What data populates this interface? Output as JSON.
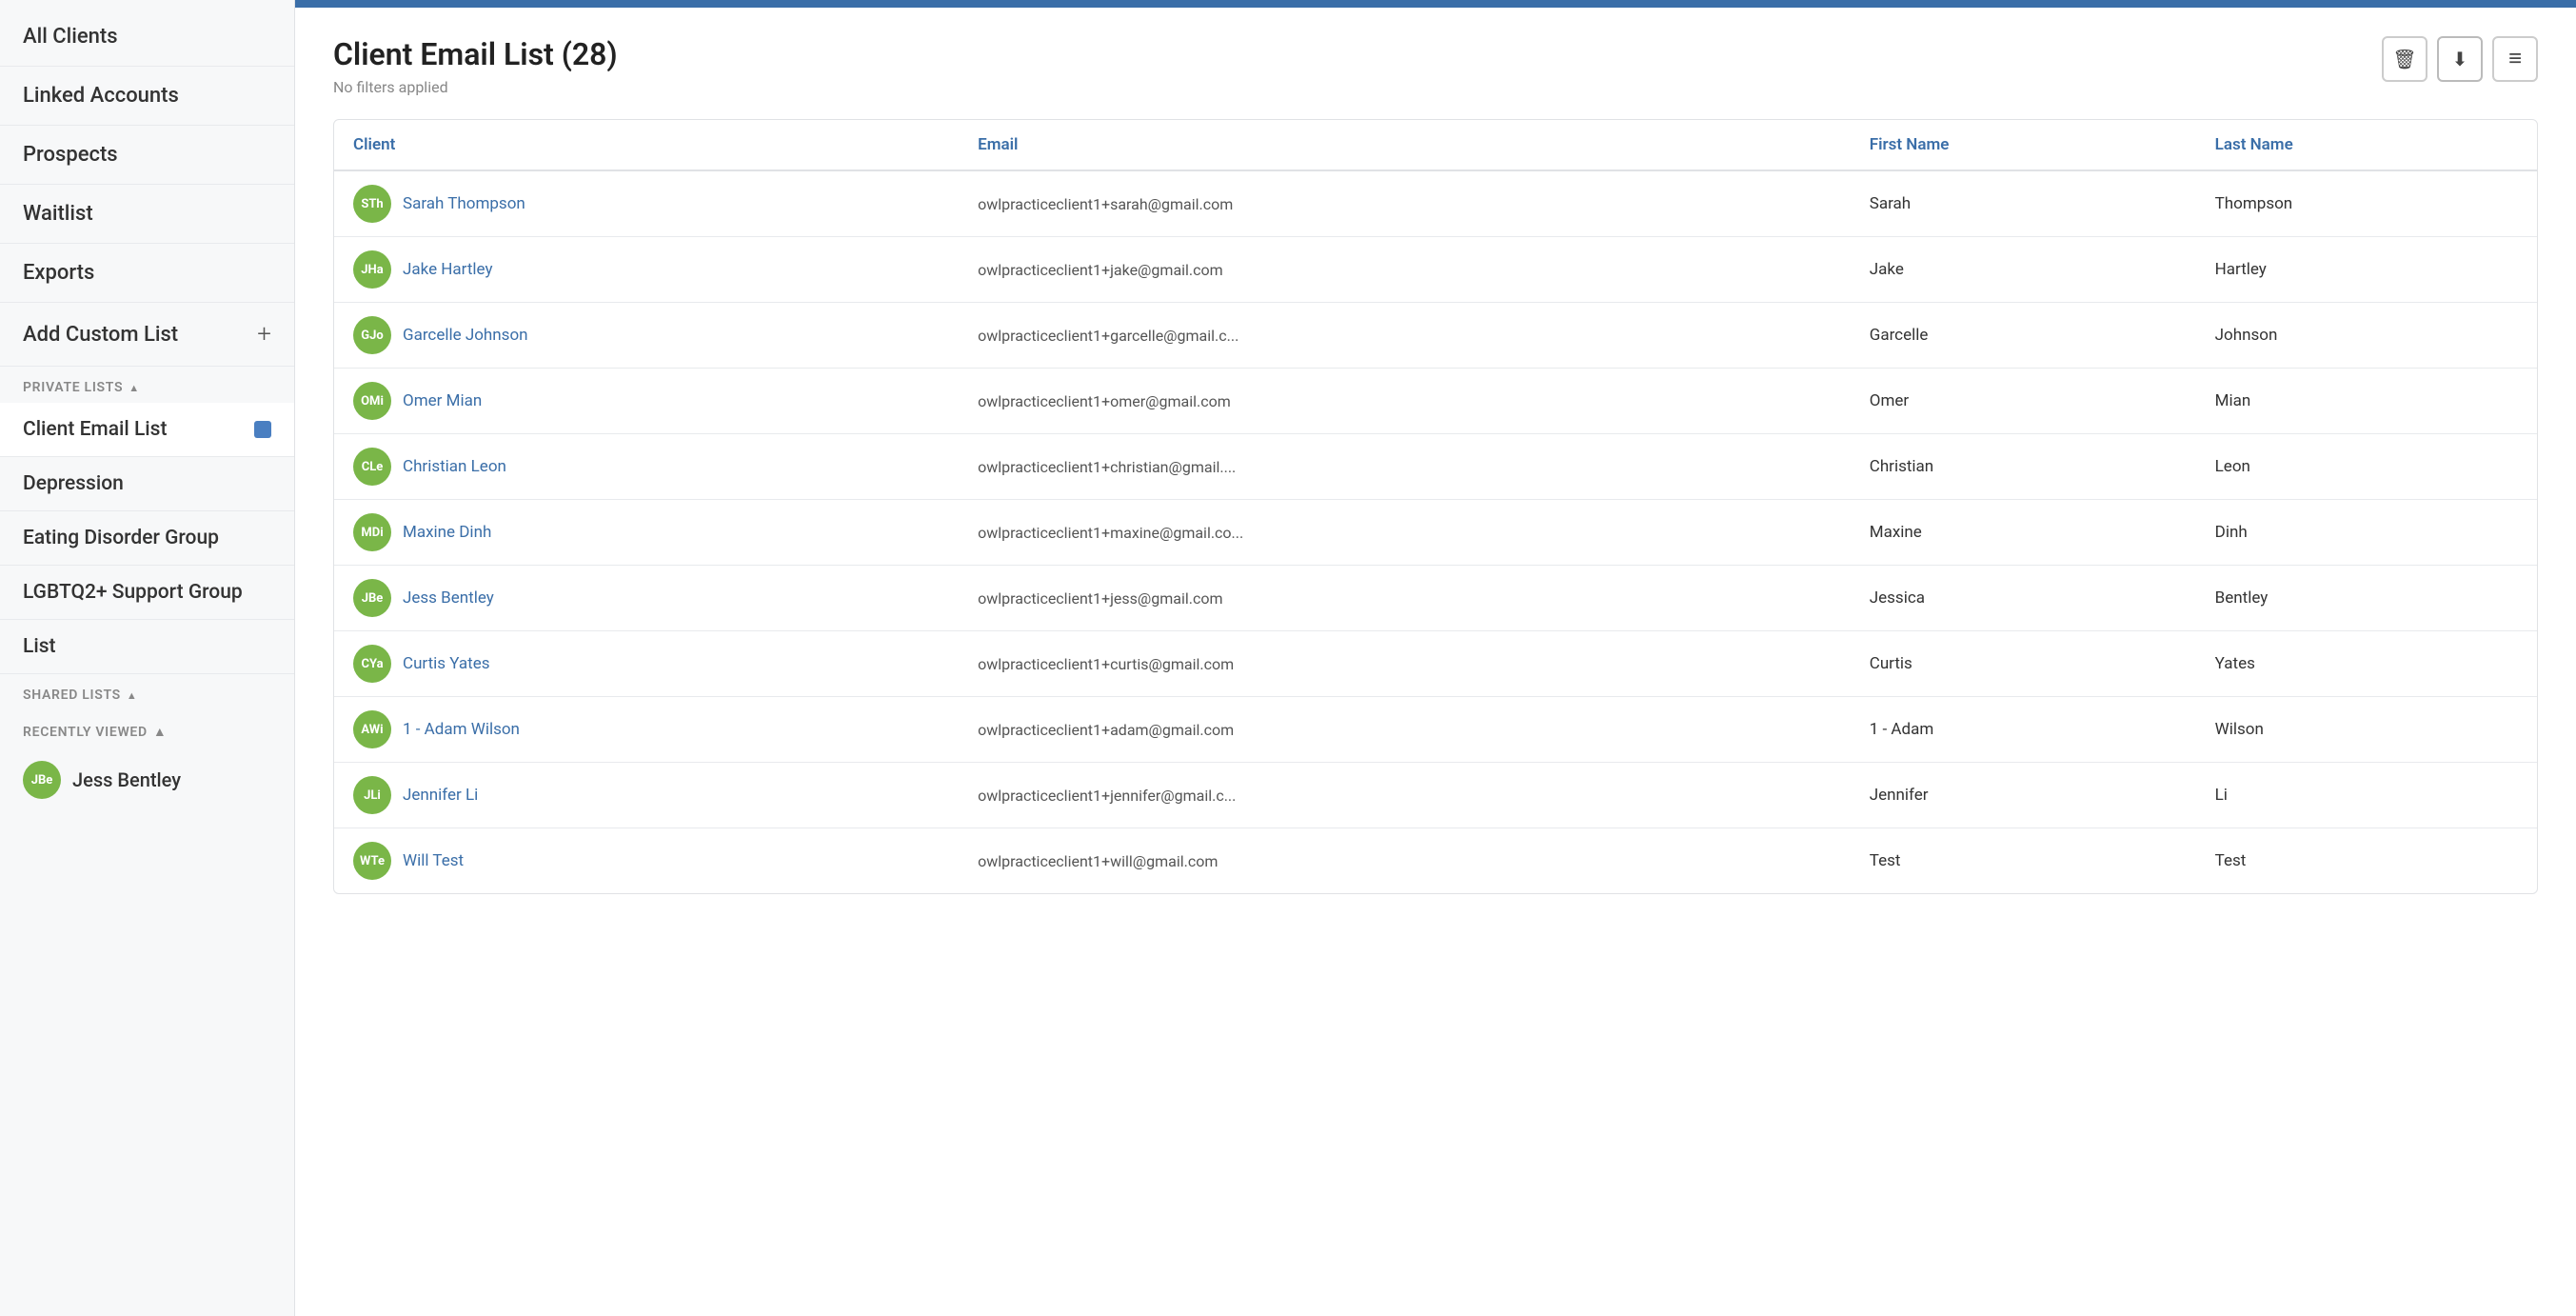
{
  "topBar": {
    "color": "#3a6ea8"
  },
  "sidebar": {
    "nav": [
      {
        "id": "all-clients",
        "label": "All Clients"
      },
      {
        "id": "linked-accounts",
        "label": "Linked Accounts"
      },
      {
        "id": "prospects",
        "label": "Prospects"
      },
      {
        "id": "waitlist",
        "label": "Waitlist"
      },
      {
        "id": "exports",
        "label": "Exports"
      }
    ],
    "addCustomList": {
      "label": "Add Custom List",
      "plus": "+"
    },
    "privateLists": {
      "sectionLabel": "PRIVATE LISTS",
      "items": [
        {
          "id": "client-email-list",
          "label": "Client Email List",
          "active": true,
          "hasDot": true
        },
        {
          "id": "depression",
          "label": "Depression",
          "active": false,
          "hasDot": false
        },
        {
          "id": "eating-disorder-group",
          "label": "Eating Disorder Group",
          "active": false,
          "hasDot": false
        },
        {
          "id": "lgbtq2-support-group",
          "label": "LGBTQ2+ Support Group",
          "active": false,
          "hasDot": false
        },
        {
          "id": "list",
          "label": "List",
          "active": false,
          "hasDot": false
        }
      ]
    },
    "sharedLists": {
      "sectionLabel": "SHARED LISTS"
    },
    "recentlyViewed": {
      "sectionLabel": "RECENTLY VIEWED",
      "items": [
        {
          "id": "jess-bentley",
          "label": "Jess Bentley",
          "initials": "JBe",
          "color": "#7ab648"
        }
      ]
    }
  },
  "main": {
    "title": "Client Email List (28)",
    "subtitle": "No filters applied",
    "columns": [
      "Client",
      "Email",
      "First Name",
      "Last Name"
    ],
    "rows": [
      {
        "initials": "STh",
        "color": "#7ab648",
        "name": "Sarah Thompson",
        "email": "owlpracticeclient1+sarah@gmail.com",
        "firstName": "Sarah",
        "lastName": "Thompson"
      },
      {
        "initials": "JHa",
        "color": "#7ab648",
        "name": "Jake Hartley",
        "email": "owlpracticeclient1+jake@gmail.com",
        "firstName": "Jake",
        "lastName": "Hartley"
      },
      {
        "initials": "GJo",
        "color": "#7ab648",
        "name": "Garcelle Johnson",
        "email": "owlpracticeclient1+garcelle@gmail.c...",
        "firstName": "Garcelle",
        "lastName": "Johnson"
      },
      {
        "initials": "OMi",
        "color": "#7ab648",
        "name": "Omer Mian",
        "email": "owlpracticeclient1+omer@gmail.com",
        "firstName": "Omer",
        "lastName": "Mian"
      },
      {
        "initials": "CLe",
        "color": "#7ab648",
        "name": "Christian Leon",
        "email": "owlpracticeclient1+christian@gmail....",
        "firstName": "Christian",
        "lastName": "Leon"
      },
      {
        "initials": "MDi",
        "color": "#7ab648",
        "name": "Maxine Dinh",
        "email": "owlpracticeclient1+maxine@gmail.co...",
        "firstName": "Maxine",
        "lastName": "Dinh"
      },
      {
        "initials": "JBe",
        "color": "#7ab648",
        "name": "Jess Bentley",
        "email": "owlpracticeclient1+jess@gmail.com",
        "firstName": "Jessica",
        "lastName": "Bentley"
      },
      {
        "initials": "CYa",
        "color": "#7ab648",
        "name": "Curtis Yates",
        "email": "owlpracticeclient1+curtis@gmail.com",
        "firstName": "Curtis",
        "lastName": "Yates"
      },
      {
        "initials": "AWi",
        "color": "#7ab648",
        "name": "1 - Adam Wilson",
        "email": "owlpracticeclient1+adam@gmail.com",
        "firstName": "1 - Adam",
        "lastName": "Wilson"
      },
      {
        "initials": "JLi",
        "color": "#7ab648",
        "name": "Jennifer Li",
        "email": "owlpracticeclient1+jennifer@gmail.c...",
        "firstName": "Jennifer",
        "lastName": "Li"
      },
      {
        "initials": "WTe",
        "color": "#7ab648",
        "name": "Will Test",
        "email": "owlpracticeclient1+will@gmail.com",
        "firstName": "Test",
        "lastName": "Test"
      }
    ],
    "icons": {
      "delete": "🗑",
      "download": "⬇",
      "filter": "≡"
    }
  }
}
